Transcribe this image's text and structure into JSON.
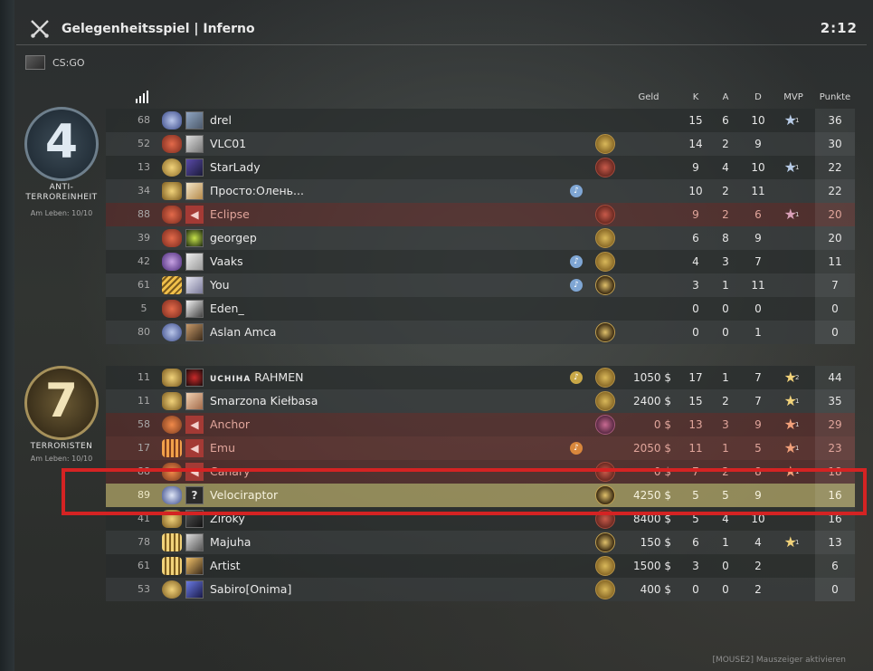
{
  "header": {
    "title": "Gelegenheitsspiel | Inferno",
    "timer": "2:12",
    "game": "CS:GO"
  },
  "columns": {
    "money": "Geld",
    "k": "K",
    "a": "A",
    "d": "D",
    "mvp": "MVP",
    "score": "Punkte"
  },
  "ct": {
    "score": "4",
    "name_line1": "ANTI-",
    "name_line2": "TERROREINHEIT",
    "alive": "Am Leben: 10/10",
    "players": [
      {
        "ping": "68",
        "name": "drel",
        "money": "",
        "k": "15",
        "a": "6",
        "d": "10",
        "mvp": "1",
        "score": "36"
      },
      {
        "ping": "52",
        "name": "VLC01",
        "money": "",
        "k": "14",
        "a": "2",
        "d": "9",
        "mvp": "",
        "score": "30"
      },
      {
        "ping": "13",
        "name": "StarLady",
        "money": "",
        "k": "9",
        "a": "4",
        "d": "10",
        "mvp": "1",
        "score": "22"
      },
      {
        "ping": "34",
        "name": "Просто:Олень...",
        "money": "",
        "k": "10",
        "a": "2",
        "d": "11",
        "mvp": "",
        "score": "22"
      },
      {
        "ping": "88",
        "name": "Eclipse",
        "money": "",
        "k": "9",
        "a": "2",
        "d": "6",
        "mvp": "1",
        "score": "20"
      },
      {
        "ping": "39",
        "name": "georgep",
        "money": "",
        "k": "6",
        "a": "8",
        "d": "9",
        "mvp": "",
        "score": "20"
      },
      {
        "ping": "42",
        "name": "Vaaks",
        "money": "",
        "k": "4",
        "a": "3",
        "d": "7",
        "mvp": "",
        "score": "11"
      },
      {
        "ping": "61",
        "name": "You",
        "money": "",
        "k": "3",
        "a": "1",
        "d": "11",
        "mvp": "",
        "score": "7"
      },
      {
        "ping": "5",
        "name": "Eden_",
        "money": "",
        "k": "0",
        "a": "0",
        "d": "0",
        "mvp": "",
        "score": "0"
      },
      {
        "ping": "80",
        "name": "Aslan Amca",
        "money": "",
        "k": "0",
        "a": "0",
        "d": "1",
        "mvp": "",
        "score": "0"
      }
    ]
  },
  "t": {
    "score": "7",
    "name_line1": "TERRORISTEN",
    "alive": "Am Leben: 10/10",
    "players": [
      {
        "ping": "11",
        "clan": "UCHIHA",
        "name": "RAHMEN",
        "money": "1050 $",
        "k": "17",
        "a": "1",
        "d": "7",
        "mvp": "2",
        "score": "44"
      },
      {
        "ping": "11",
        "name": "Smarzona Kiełbasa",
        "money": "2400 $",
        "k": "15",
        "a": "2",
        "d": "7",
        "mvp": "1",
        "score": "35"
      },
      {
        "ping": "58",
        "name": "Anchor",
        "money": "0 $",
        "k": "13",
        "a": "3",
        "d": "9",
        "mvp": "1",
        "score": "29"
      },
      {
        "ping": "17",
        "name": "Emu",
        "money": "2050 $",
        "k": "11",
        "a": "1",
        "d": "5",
        "mvp": "1",
        "score": "23"
      },
      {
        "ping": "88",
        "name": "Canary",
        "money": "0 $",
        "k": "7",
        "a": "2",
        "d": "8",
        "mvp": "1",
        "score": "18"
      },
      {
        "ping": "89",
        "name": "Velociraptor",
        "money": "4250 $",
        "k": "5",
        "a": "5",
        "d": "9",
        "mvp": "",
        "score": "16"
      },
      {
        "ping": "41",
        "name": "Ziroky",
        "money": "8400 $",
        "k": "5",
        "a": "4",
        "d": "10",
        "mvp": "",
        "score": "16"
      },
      {
        "ping": "78",
        "name": "Majuha",
        "money": "150 $",
        "k": "6",
        "a": "1",
        "d": "4",
        "mvp": "1",
        "score": "13"
      },
      {
        "ping": "61",
        "name": "Artist",
        "money": "1500 $",
        "k": "3",
        "a": "0",
        "d": "2",
        "mvp": "",
        "score": "6"
      },
      {
        "ping": "53",
        "name": "Sabiro[Onima]",
        "money": "400 $",
        "k": "0",
        "a": "0",
        "d": "2",
        "mvp": "",
        "score": "0"
      }
    ]
  },
  "hint": "[MOUSE2] Mauszeiger aktivieren",
  "colors": {
    "highlight": "#d42323",
    "ct_accent": "#6e7f8c",
    "t_accent": "#a6915b"
  }
}
